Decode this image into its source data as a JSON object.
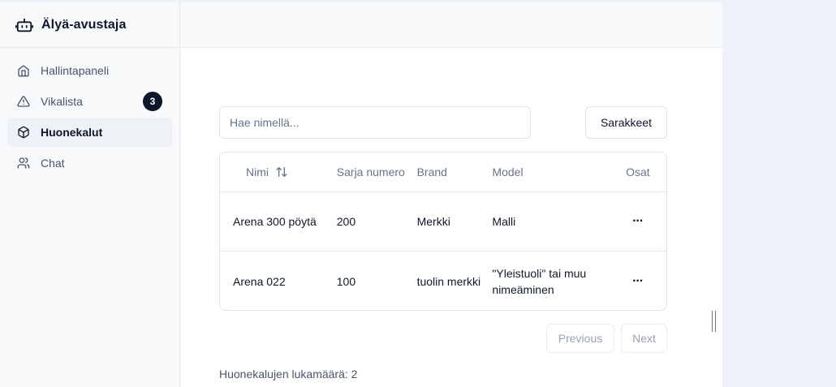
{
  "app": {
    "name": "Älyä-avustaja"
  },
  "sidebar": {
    "items": [
      {
        "label": "Hallintapaneli",
        "icon": "home-icon"
      },
      {
        "label": "Vikalista",
        "icon": "alert-triangle-icon",
        "badge": "3"
      },
      {
        "label": "Huonekalut",
        "icon": "box-icon",
        "active": true
      },
      {
        "label": "Chat",
        "icon": "users-icon"
      }
    ]
  },
  "toolbar": {
    "search_placeholder": "Hae nimellä...",
    "columns_label": "Sarakkeet"
  },
  "table": {
    "headers": [
      "Nimi",
      "Sarja numero",
      "Brand",
      "Model",
      "Osat"
    ],
    "rows": [
      {
        "name": "Arena 300 pöytä",
        "serial": "200",
        "brand": "Merkki",
        "model": "Malli",
        "parts": "···"
      },
      {
        "name": "Arena 022",
        "serial": "100",
        "brand": "tuolin merkki",
        "model": "\"Yleistuoli\" tai muu nimeäminen",
        "parts": "···"
      }
    ]
  },
  "pagination": {
    "previous": "Previous",
    "next": "Next"
  },
  "footer": {
    "count_text": "Huonekalujen lukamäärä: 2"
  },
  "colors": {
    "accent": "#0f172a",
    "muted": "#64748b",
    "border": "#e2e6ec"
  }
}
